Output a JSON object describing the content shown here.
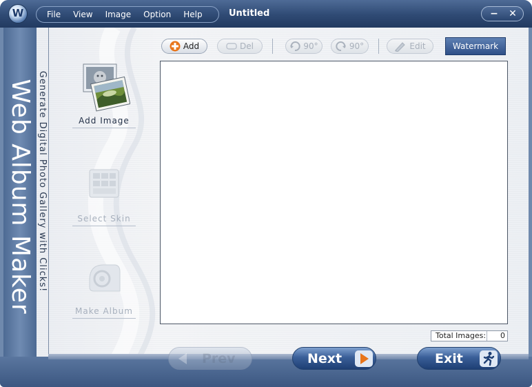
{
  "app": {
    "document_title": "Untitled",
    "brand_name": "Web Album Maker",
    "tagline": "Generate Digital Photo Gallery with Clicks!"
  },
  "window_controls": {
    "minimize": "−",
    "close": "✕"
  },
  "menu": [
    {
      "label": "File"
    },
    {
      "label": "View"
    },
    {
      "label": "Image"
    },
    {
      "label": "Option"
    },
    {
      "label": "Help"
    }
  ],
  "steps": [
    {
      "label": "Add  Image",
      "icon": "photos-icon",
      "enabled": true
    },
    {
      "label": "Select  Skin",
      "icon": "skin-icon",
      "enabled": false
    },
    {
      "label": "Make  Album",
      "icon": "album-icon",
      "enabled": false
    }
  ],
  "toolbar": {
    "add": "Add",
    "del": "Del",
    "rotate_left": "90°",
    "rotate_right": "90°",
    "edit": "Edit",
    "watermark": "Watermark"
  },
  "status": {
    "total_label": "Total Images:",
    "total_value": "0"
  },
  "nav": {
    "prev": "Prev",
    "next": "Next",
    "exit": "Exit"
  },
  "colors": {
    "title_bar": "#2f4a74",
    "brand_bar": "#6f8bb2",
    "accent_orange": "#e8751a",
    "watermark_button": "#3a5c93"
  }
}
